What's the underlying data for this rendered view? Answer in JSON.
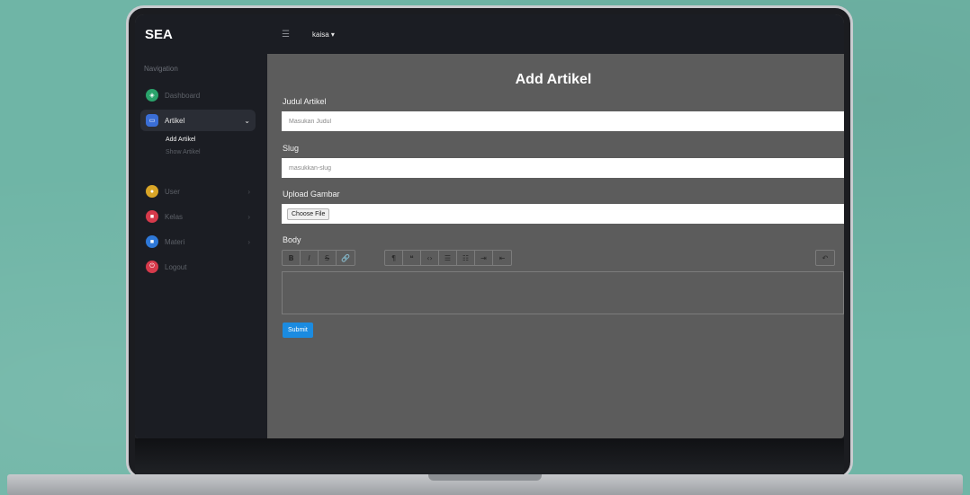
{
  "app": {
    "brand": "SEA"
  },
  "topbar": {
    "menu_icon": "hamburger-icon",
    "user": "kaisa ▾"
  },
  "sidebar": {
    "heading": "Navigation",
    "items": [
      {
        "label": "Dashboard",
        "icon": "dashboard-icon",
        "color": "#2aa36b"
      },
      {
        "label": "Artikel",
        "icon": "artikel-icon",
        "color": "#3a6ed6",
        "caret": "⌄"
      },
      {
        "label": "User",
        "icon": "user-icon",
        "color": "#d9a527",
        "caret": "›"
      },
      {
        "label": "Kelas",
        "icon": "kelas-icon",
        "color": "#d63a4b",
        "caret": "›"
      },
      {
        "label": "Materi",
        "icon": "materi-icon",
        "color": "#2e78d8",
        "caret": "›"
      },
      {
        "label": "Logout",
        "icon": "logout-icon",
        "color": "#d63a4b"
      }
    ],
    "sub_items": [
      "Add Artikel",
      "Show Artikel"
    ]
  },
  "form": {
    "title": "Add Artikel",
    "judul_label": "Judul Artikel",
    "judul_placeholder": "Masukan Judul",
    "slug_label": "Slug",
    "slug_placeholder": "masukkan-slug",
    "upload_label": "Upload Gambar",
    "choose_file": "Choose File",
    "body_label": "Body",
    "submit": "Submit"
  },
  "editor_toolbar": {
    "groups": [
      [
        "B",
        "I",
        "S",
        "🔗"
      ],
      [
        "¶",
        "❝",
        "‹›",
        "☰",
        "☷",
        "⇥",
        "⇤"
      ],
      [
        "↶"
      ]
    ],
    "icons": [
      "bold-icon",
      "italic-icon",
      "strikethrough-icon",
      "link-icon",
      "heading-icon",
      "quote-icon",
      "code-icon",
      "bullet-list-icon",
      "numbered-list-icon",
      "indent-icon",
      "outdent-icon",
      "undo-icon"
    ]
  },
  "colors": {
    "sidebar": "#1b1d23",
    "content": "#5c5c5c",
    "accent": "#1b8be0",
    "desk": "#6fb5a6"
  }
}
